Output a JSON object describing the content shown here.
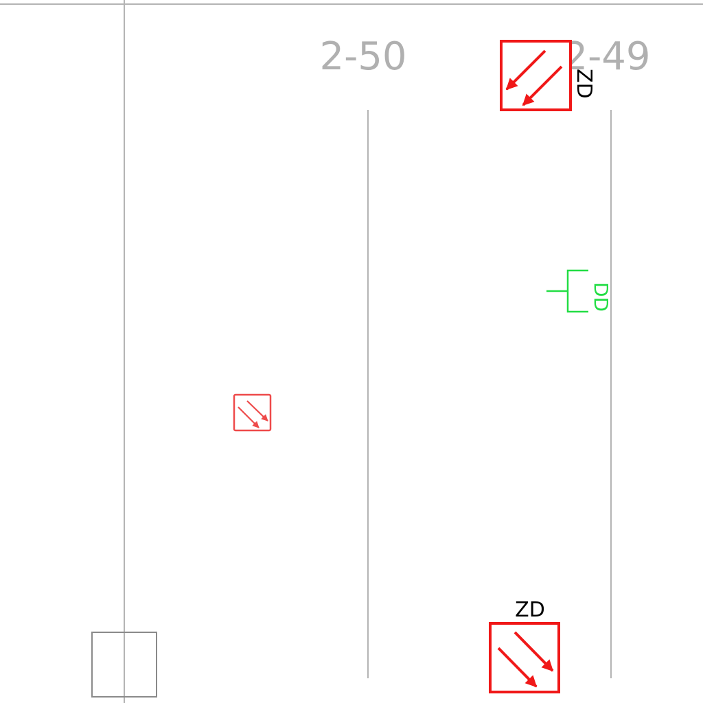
{
  "grid_labels": {
    "left": "2-50",
    "right": "2-49"
  },
  "tags": {
    "top_device": "ZD",
    "bottom_device": "ZD",
    "green_device": "DD"
  },
  "colors": {
    "grid_line": "#b4b4b4",
    "grid_text": "#b0b0b0",
    "device_red": "#f01818",
    "device_red_light": "#ee4a4a",
    "device_green": "#22dd44",
    "tag_text": "#000000",
    "column_box": "#8a8a8a",
    "background": "#ffffff"
  },
  "icons": {
    "top_device": "smoke-damper-symbol-icon",
    "bottom_device": "smoke-damper-symbol-icon",
    "small_device": "damper-symbol-icon",
    "green_device": "duct-branch-icon"
  }
}
